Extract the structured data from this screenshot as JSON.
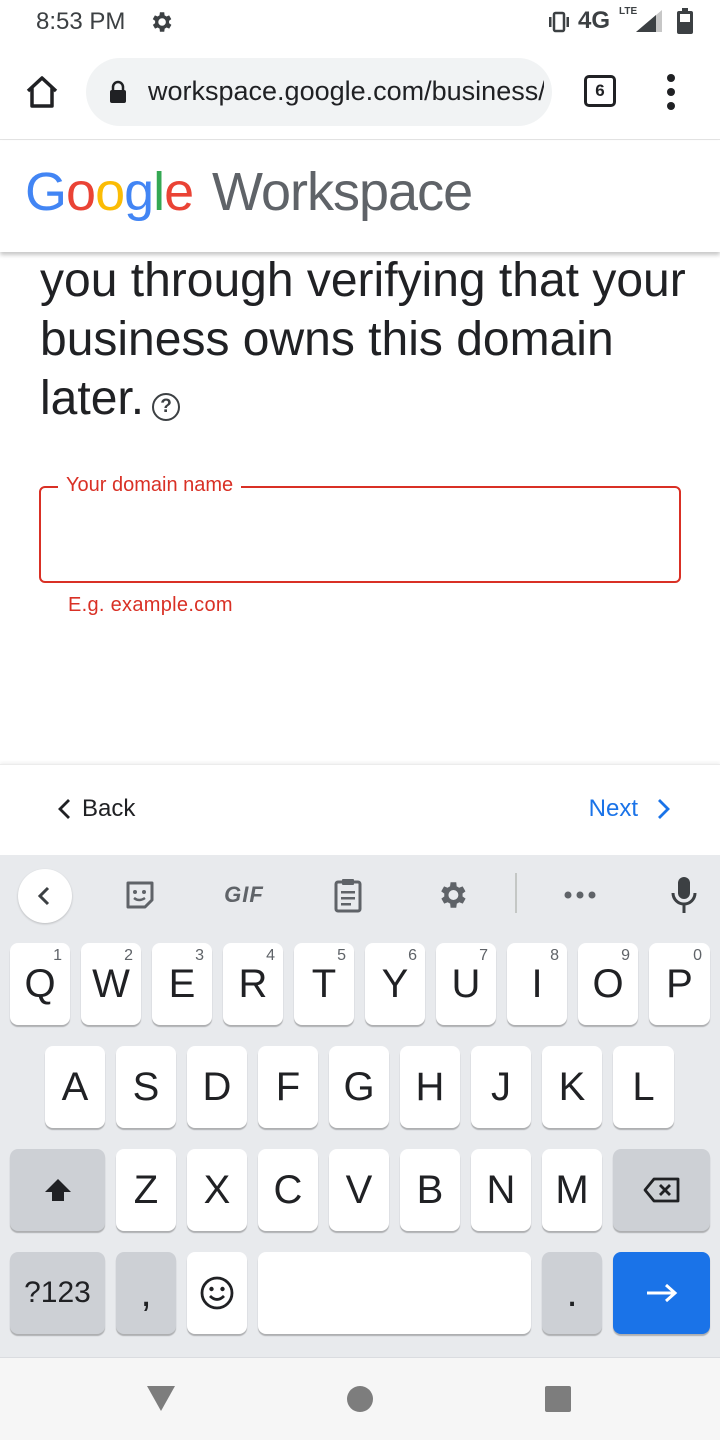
{
  "status_bar": {
    "time": "8:53 PM",
    "network": "4G",
    "network_sub": "LTE",
    "icons": [
      "gear-icon",
      "vibrate-icon",
      "signal-icon",
      "battery-icon"
    ]
  },
  "browser": {
    "url": "workspace.google.com/business/signup",
    "tab_count": "6",
    "icons": [
      "home-icon",
      "lock-icon",
      "more-vert-icon"
    ]
  },
  "header": {
    "brand_letters": [
      "G",
      "o",
      "o",
      "g",
      "l",
      "e"
    ],
    "product": "Workspace",
    "brand_colors": [
      "#4285f4",
      "#ea4335",
      "#fbbc05",
      "#4285f4",
      "#34a853",
      "#ea4335"
    ]
  },
  "main": {
    "description": "info@example.com. We'll walk you through verifying that your business owns this domain later.",
    "domain_field": {
      "label": "Your domain name",
      "value": "",
      "hint": "E.g. example.com"
    }
  },
  "nav": {
    "back_label": "Back",
    "next_label": "Next"
  },
  "keyboard": {
    "toolbar": {
      "gif_label": "GIF",
      "icons": [
        "collapse-icon",
        "sticker-icon",
        "clipboard-icon",
        "settings-icon",
        "more-icon",
        "mic-icon"
      ]
    },
    "row1": [
      {
        "key": "Q",
        "hint": "1"
      },
      {
        "key": "W",
        "hint": "2"
      },
      {
        "key": "E",
        "hint": "3"
      },
      {
        "key": "R",
        "hint": "4"
      },
      {
        "key": "T",
        "hint": "5"
      },
      {
        "key": "Y",
        "hint": "6"
      },
      {
        "key": "U",
        "hint": "7"
      },
      {
        "key": "I",
        "hint": "8"
      },
      {
        "key": "O",
        "hint": "9"
      },
      {
        "key": "P",
        "hint": "0"
      }
    ],
    "row2": [
      "A",
      "S",
      "D",
      "F",
      "G",
      "H",
      "J",
      "K",
      "L"
    ],
    "row3": [
      "Z",
      "X",
      "C",
      "V",
      "B",
      "N",
      "M"
    ],
    "row4": {
      "symbols_label": "?123",
      "comma": ",",
      "period": "."
    }
  },
  "colors": {
    "accent": "#1a73e8",
    "error": "#d93025",
    "keyboard_bg": "#e8eaed"
  }
}
